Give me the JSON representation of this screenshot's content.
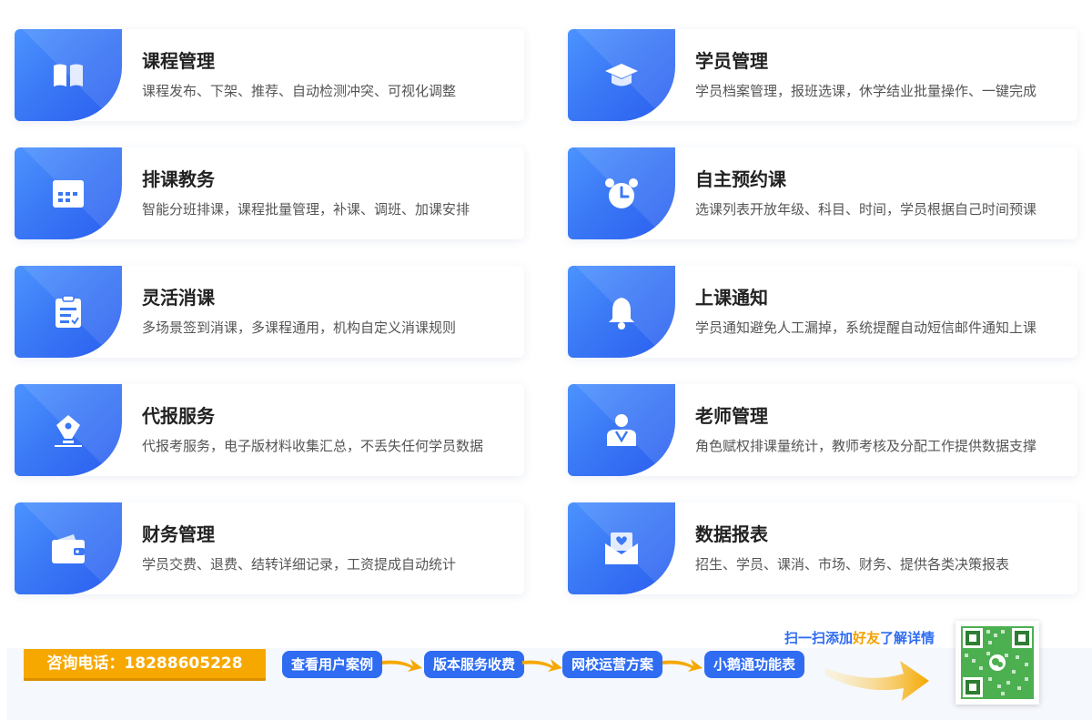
{
  "features": [
    {
      "title": "课程管理",
      "desc": "课程发布、下架、推荐、自动检测冲突、可视化调整",
      "icon": "book-icon"
    },
    {
      "title": "学员管理",
      "desc": "学员档案管理，报班选课，休学结业批量操作、一键完成",
      "icon": "graduation-cap-icon"
    },
    {
      "title": "排课教务",
      "desc": "智能分班排课，课程批量管理，补课、调班、加课安排",
      "icon": "calendar-icon"
    },
    {
      "title": "自主预约课",
      "desc": "选课列表开放年级、科目、时间，学员根据自己时间预课",
      "icon": "alarm-clock-icon"
    },
    {
      "title": "灵活消课",
      "desc": "多场景签到消课，多课程通用，机构自定义消课规则",
      "icon": "clipboard-icon"
    },
    {
      "title": "上课通知",
      "desc": "学员通知避免人工漏掉，系统提醒自动短信邮件通知上课",
      "icon": "bell-icon"
    },
    {
      "title": "代报服务",
      "desc": "代报考服务，电子版材料收集汇总，不丢失任何学员数据",
      "icon": "pen-nib-icon"
    },
    {
      "title": "老师管理",
      "desc": "角色赋权排课量统计，教师考核及分配工作提供数据支撑",
      "icon": "teacher-icon"
    },
    {
      "title": "财务管理",
      "desc": "学员交费、退费、结转详细记录，工资提成自动统计",
      "icon": "wallet-icon"
    },
    {
      "title": "数据报表",
      "desc": "招生、学员、课消、市场、财务、提供各类决策报表",
      "icon": "envelope-heart-icon"
    }
  ],
  "footer": {
    "phone_label": "咨询电话：18288605228",
    "links": [
      "查看用户案例",
      "版本服务收费",
      "网校运营方案",
      "小鹅通功能表"
    ],
    "scan_prefix": "扫一扫添加",
    "scan_highlight": "好友",
    "scan_suffix": "了解详情",
    "accent": "#2f6cf2",
    "highlight": "#f5a000"
  }
}
